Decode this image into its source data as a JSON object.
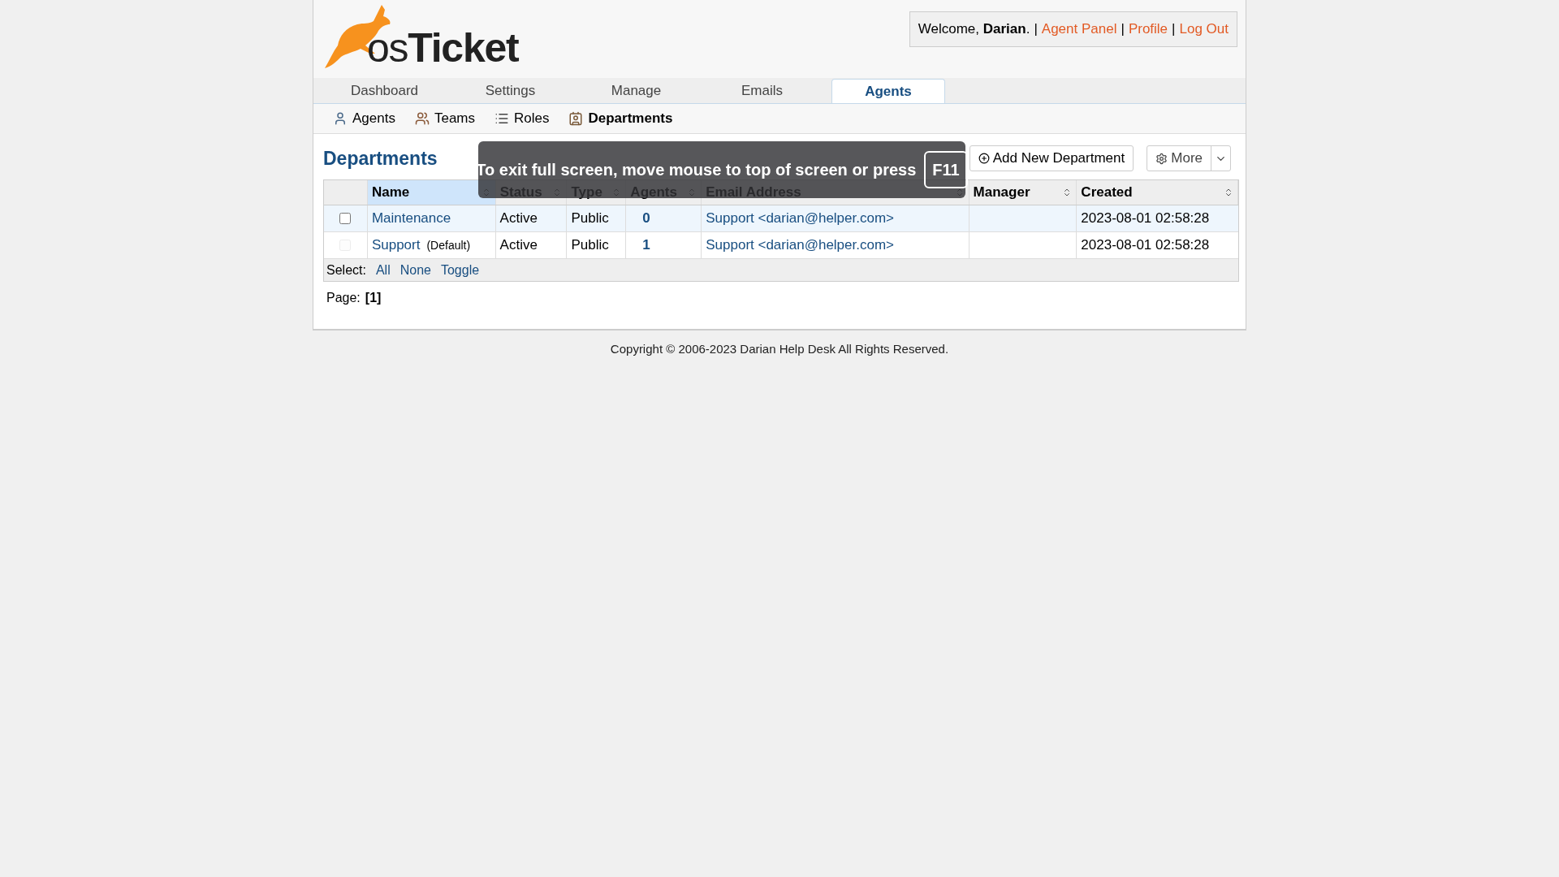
{
  "header": {
    "logo": "os**Ticket**",
    "welcome": "Welcome, **Darian**.",
    "links": [
      "Agent Panel",
      "Profile",
      "Log Out"
    ],
    "separator": "|"
  },
  "tabs": [
    {
      "label": "Dashboard",
      "selected": false
    },
    {
      "label": "Settings",
      "selected": false
    },
    {
      "label": "Manage",
      "selected": false
    },
    {
      "label": "Emails",
      "selected": false
    },
    {
      "label": "Agents",
      "selected": true
    }
  ],
  "subnav": [
    {
      "label": "Agents",
      "kind": "agent",
      "selected": false
    },
    {
      "label": "Teams",
      "kind": "team",
      "selected": false
    },
    {
      "label": "Roles",
      "kind": "role",
      "selected": false
    },
    {
      "label": "Departments",
      "kind": "department",
      "selected": true
    }
  ],
  "page_title": "Departments",
  "actions": {
    "add": "Add New Department",
    "more": "More"
  },
  "table": {
    "columns": [
      {
        "label": "Name",
        "sorted": true
      },
      {
        "label": "Status",
        "sorted": false
      },
      {
        "label": "Type",
        "sorted": false
      },
      {
        "label": "Agents",
        "sorted": false
      },
      {
        "label": "Email Address",
        "sorted": false
      },
      {
        "label": "Manager",
        "sorted": false
      },
      {
        "label": "Created",
        "sorted": false
      }
    ],
    "rows": [
      {
        "checked": false,
        "disabled": false,
        "hovered": true,
        "name": "Maintenance",
        "tag": "",
        "status": "Active",
        "type": "Public",
        "agents": "0",
        "email": "Support <darian@helper.com>",
        "manager": "",
        "created": "2023-08-01 02:58:28"
      },
      {
        "checked": false,
        "disabled": true,
        "hovered": false,
        "name": "Support",
        "tag": "(Default)",
        "status": "Active",
        "type": "Public",
        "agents": "1",
        "email": "Support <darian@helper.com>",
        "manager": "",
        "created": "2023-08-01 02:58:28"
      }
    ],
    "select_label": "Select:",
    "select_links": [
      "All",
      "None",
      "Toggle"
    ]
  },
  "pagination": {
    "label": "Page:",
    "current": "[1]"
  },
  "footer": "Copyright © 2006-2023 Darian Help Desk All Rights Reserved.",
  "fullscreen_notice": {
    "message": "To exit full screen, move mouse to top of screen or press",
    "key": "F11"
  }
}
